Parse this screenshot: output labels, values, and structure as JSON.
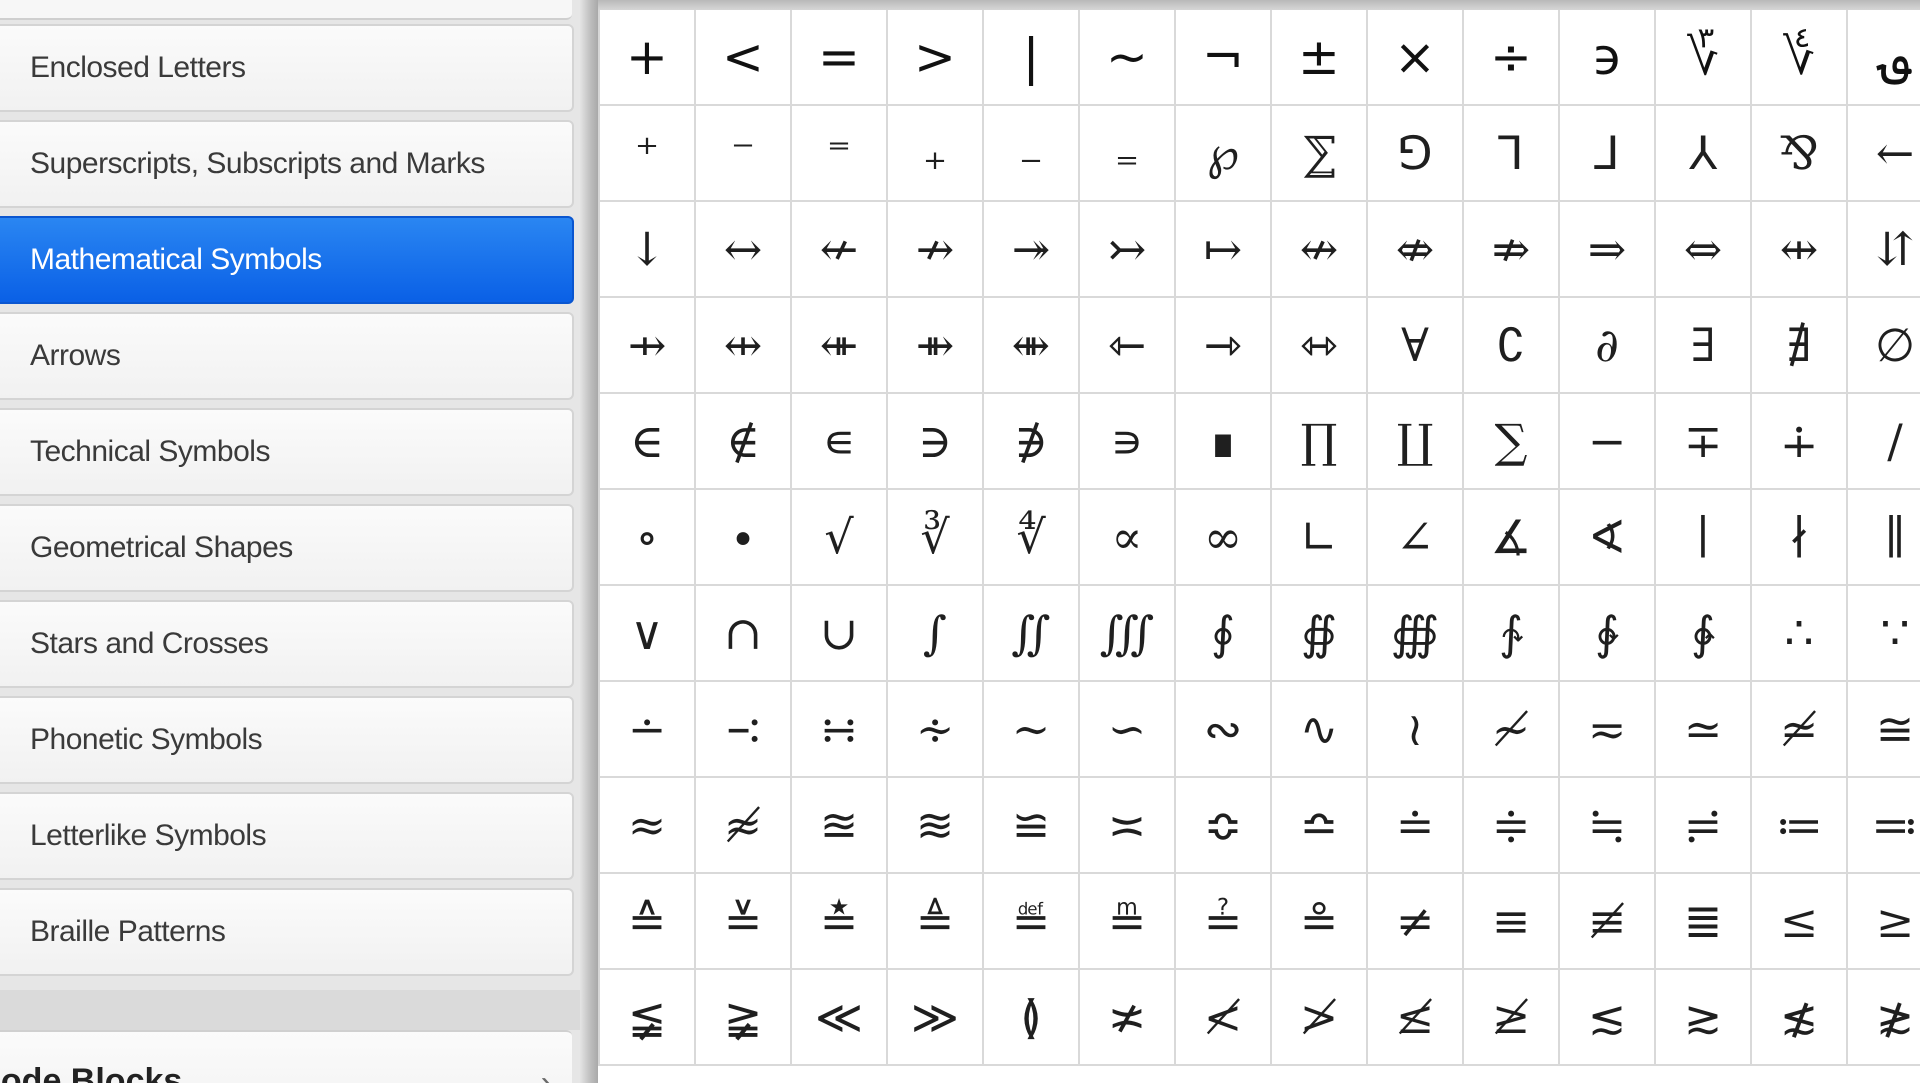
{
  "sidebar": {
    "items": [
      {
        "label": "Enclosed Letters",
        "selected": false
      },
      {
        "label": "Superscripts, Subscripts and Marks",
        "selected": false
      },
      {
        "label": "Mathematical Symbols",
        "selected": true
      },
      {
        "label": "Arrows",
        "selected": false
      },
      {
        "label": "Technical Symbols",
        "selected": false
      },
      {
        "label": "Geometrical Shapes",
        "selected": false
      },
      {
        "label": "Stars and Crosses",
        "selected": false
      },
      {
        "label": "Phonetic Symbols",
        "selected": false
      },
      {
        "label": "Letterlike Symbols",
        "selected": false
      },
      {
        "label": "Braille Patterns",
        "selected": false
      }
    ],
    "section": {
      "label": "code Blocks",
      "chevron": "›"
    }
  },
  "colors": {
    "selected_bg": "#0a60e6",
    "selected_text": "#ffffff",
    "item_text": "#3a3a3a",
    "grid_line": "#d9d9d9"
  },
  "icons": {
    "section_chevron": "chevron-right-icon"
  },
  "grid": {
    "rows": [
      [
        "+",
        "<",
        "=",
        ">",
        "|",
        "~",
        "¬",
        "±",
        "×",
        "÷",
        "϶",
        "؆",
        "؇",
        "؈"
      ],
      [
        "⁺",
        "⁻",
        "⁼",
        "₊",
        "₋",
        "₌",
        "℘",
        "⅀",
        "⅁",
        "⅂",
        "⅃",
        "⅄",
        "⅋",
        "←"
      ],
      [
        "↓",
        "↔",
        "↚",
        "↛",
        "↠",
        "↣",
        "↦",
        "↮",
        "⇎",
        "⇏",
        "⇒",
        "⇔",
        "⇹",
        "⇵"
      ],
      [
        "⇸",
        "⇹",
        "⇺",
        "⇻",
        "⇼",
        "⇽",
        "⇾",
        "⇿",
        "∀",
        "∁",
        "∂",
        "∃",
        "∄",
        "∅"
      ],
      [
        "∈",
        "∉",
        "∊",
        "∋",
        "∌",
        "∍",
        "∎",
        "∏",
        "∐",
        "∑",
        "−",
        "∓",
        "∔",
        "∕"
      ],
      [
        "∘",
        "∙",
        "√",
        "∛",
        "∜",
        "∝",
        "∞",
        "∟",
        "∠",
        "∡",
        "∢",
        "∣",
        "∤",
        "∥"
      ],
      [
        "∨",
        "∩",
        "∪",
        "∫",
        "∬",
        "∭",
        "∮",
        "∯",
        "∰",
        "∱",
        "∲",
        "∳",
        "∴",
        "∵"
      ],
      [
        "∸",
        "∹",
        "∺",
        "∻",
        "∼",
        "∽",
        "∾",
        "∿",
        "≀",
        "≁",
        "≂",
        "≃",
        "≄",
        "≅"
      ],
      [
        "≈",
        "≉",
        "≊",
        "≋",
        "≌",
        "≍",
        "≎",
        "≏",
        "≐",
        "≑",
        "≒",
        "≓",
        "≔",
        "≕"
      ],
      [
        "≙",
        "≚",
        "≛",
        "≜",
        "≝",
        "≞",
        "≟",
        "≗",
        "≠",
        "≡",
        "≢",
        "≣",
        "≤",
        "≥"
      ],
      [
        "≨",
        "≩",
        "≪",
        "≫",
        "≬",
        "≭",
        "≮",
        "≯",
        "≰",
        "≱",
        "≲",
        "≳",
        "≴",
        "≵"
      ]
    ]
  }
}
